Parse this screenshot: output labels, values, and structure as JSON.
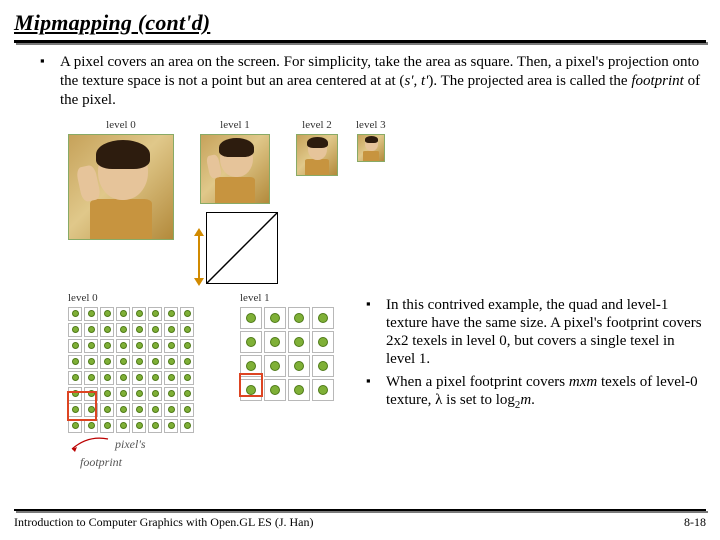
{
  "title": "Mipmapping (cont'd)",
  "bullets": {
    "top": {
      "t1": "A pixel covers an area on the screen. For simplicity, take the area as square. Then, a pixel's projection onto the texture space is not a point but an area centered at at (",
      "sp": "s', t'",
      "t2": "). The projected area is called the ",
      "fp": "footprint",
      "t3": " of the pixel."
    },
    "r1": "In this contrived example, the quad and level-1 texture have the same size. A pixel's footprint covers 2x2 texels in level 0, but covers a single texel in level 1.",
    "r2a": "When a pixel footprint covers ",
    "r2m": "m",
    "r2x": "x",
    "r2b": " texels of level-0 texture, λ is set to log",
    "r2sub": "2",
    "r2c": "m",
    "r2d": "."
  },
  "labels": {
    "lv0": "level 0",
    "lv1": "level 1",
    "lv2": "level 2",
    "lv3": "level 3",
    "pf1": "pixel's",
    "pf2": "footprint"
  },
  "footer": {
    "left": "Introduction to Computer Graphics with Open.GL ES (J. Han)",
    "right": "8-18"
  }
}
